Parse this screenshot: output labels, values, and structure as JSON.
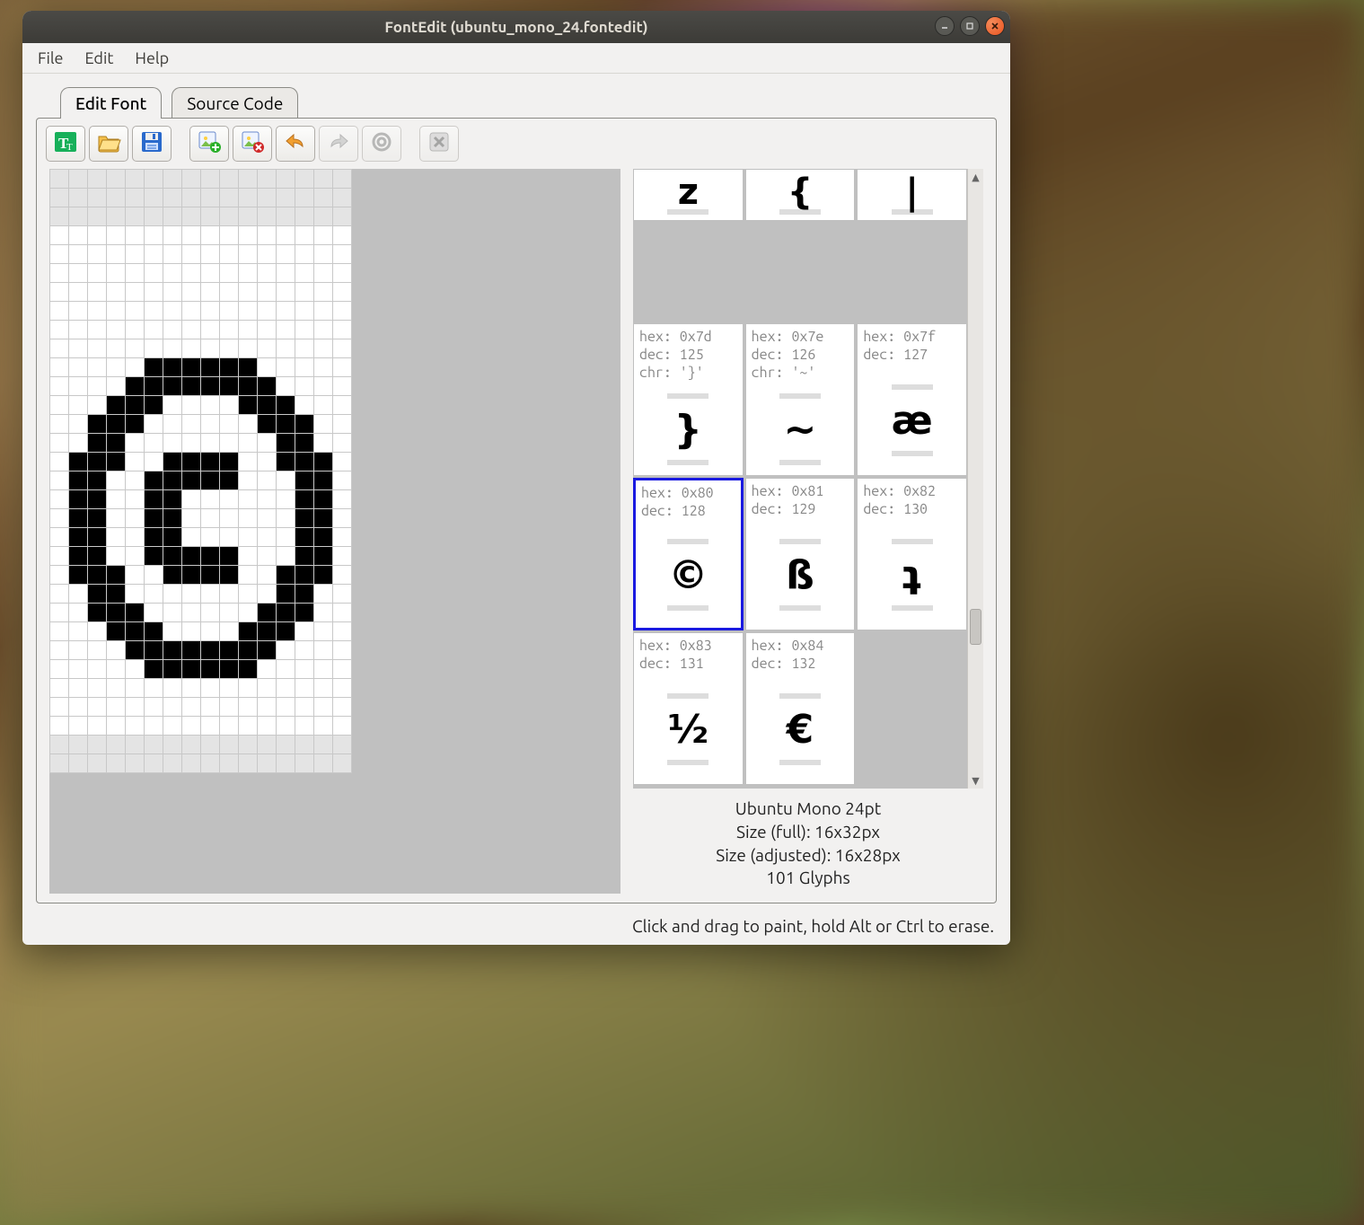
{
  "window": {
    "title": "FontEdit (ubuntu_mono_24.fontedit)"
  },
  "menubar": [
    "File",
    "Edit",
    "Help"
  ],
  "tabs": {
    "items": [
      "Edit Font",
      "Source Code"
    ],
    "active": 0
  },
  "toolbar": {
    "buttons": [
      {
        "name": "import-font-icon",
        "enabled": true
      },
      {
        "name": "open-icon",
        "enabled": true
      },
      {
        "name": "save-icon",
        "enabled": true
      },
      {
        "sep": true
      },
      {
        "name": "add-glyph-icon",
        "enabled": true
      },
      {
        "name": "remove-glyph-icon",
        "enabled": true
      },
      {
        "name": "undo-icon",
        "enabled": true
      },
      {
        "name": "redo-icon",
        "enabled": false
      },
      {
        "name": "reset-icon",
        "enabled": false
      },
      {
        "sep": true
      },
      {
        "name": "close-icon",
        "enabled": false
      }
    ]
  },
  "editor": {
    "cols": 16,
    "rows_visible": 32,
    "margin_top_rows": 3,
    "margin_bottom_rows": 2,
    "pixels": [
      "0000000000000000",
      "0000000000000000",
      "0000000000000000",
      "0000000000000000",
      "0000000000000000",
      "0000000000000000",
      "0000000000000000",
      "0000000000000000",
      "0000000000000000",
      "0000000000000000",
      "0000011111100000",
      "0000111111110000",
      "0001110000111000",
      "0011100000011100",
      "0011000000001100",
      "0111001111001110",
      "0110011111000110",
      "0110011000000110",
      "0110011000000110",
      "0110011000000110",
      "0110011111000110",
      "0111001111001110",
      "0011000000001100",
      "0011100000011100",
      "0001110000111000",
      "0000111111110000",
      "0000011111100000",
      "0000000000000000",
      "0000000000000000",
      "0000000000000000",
      "0000000000000000",
      "0000000000000000"
    ]
  },
  "glyph_palette": {
    "stub_row": [
      {
        "glyph": "z"
      },
      {
        "glyph": "{"
      },
      {
        "glyph": "|"
      }
    ],
    "rows": [
      [
        {
          "hex": "0x7d",
          "dec": 125,
          "chr": "'}'",
          "glyph": "}"
        },
        {
          "hex": "0x7e",
          "dec": 126,
          "chr": "'~'",
          "glyph": "~"
        },
        {
          "hex": "0x7f",
          "dec": 127,
          "glyph": "æ"
        }
      ],
      [
        {
          "hex": "0x80",
          "dec": 128,
          "glyph": "©",
          "selected": true
        },
        {
          "hex": "0x81",
          "dec": 129,
          "glyph": "ß"
        },
        {
          "hex": "0x82",
          "dec": 130,
          "glyph": "ʇ"
        }
      ],
      [
        {
          "hex": "0x83",
          "dec": 131,
          "glyph": "½"
        },
        {
          "hex": "0x84",
          "dec": 132,
          "glyph": "€"
        },
        {
          "empty": true
        }
      ]
    ]
  },
  "font_info": {
    "line1": "Ubuntu Mono 24pt",
    "line2": "Size (full): 16x32px",
    "line3": "Size (adjusted): 16x28px",
    "line4": "101 Glyphs"
  },
  "status": "Click and drag to paint, hold Alt or Ctrl to erase."
}
